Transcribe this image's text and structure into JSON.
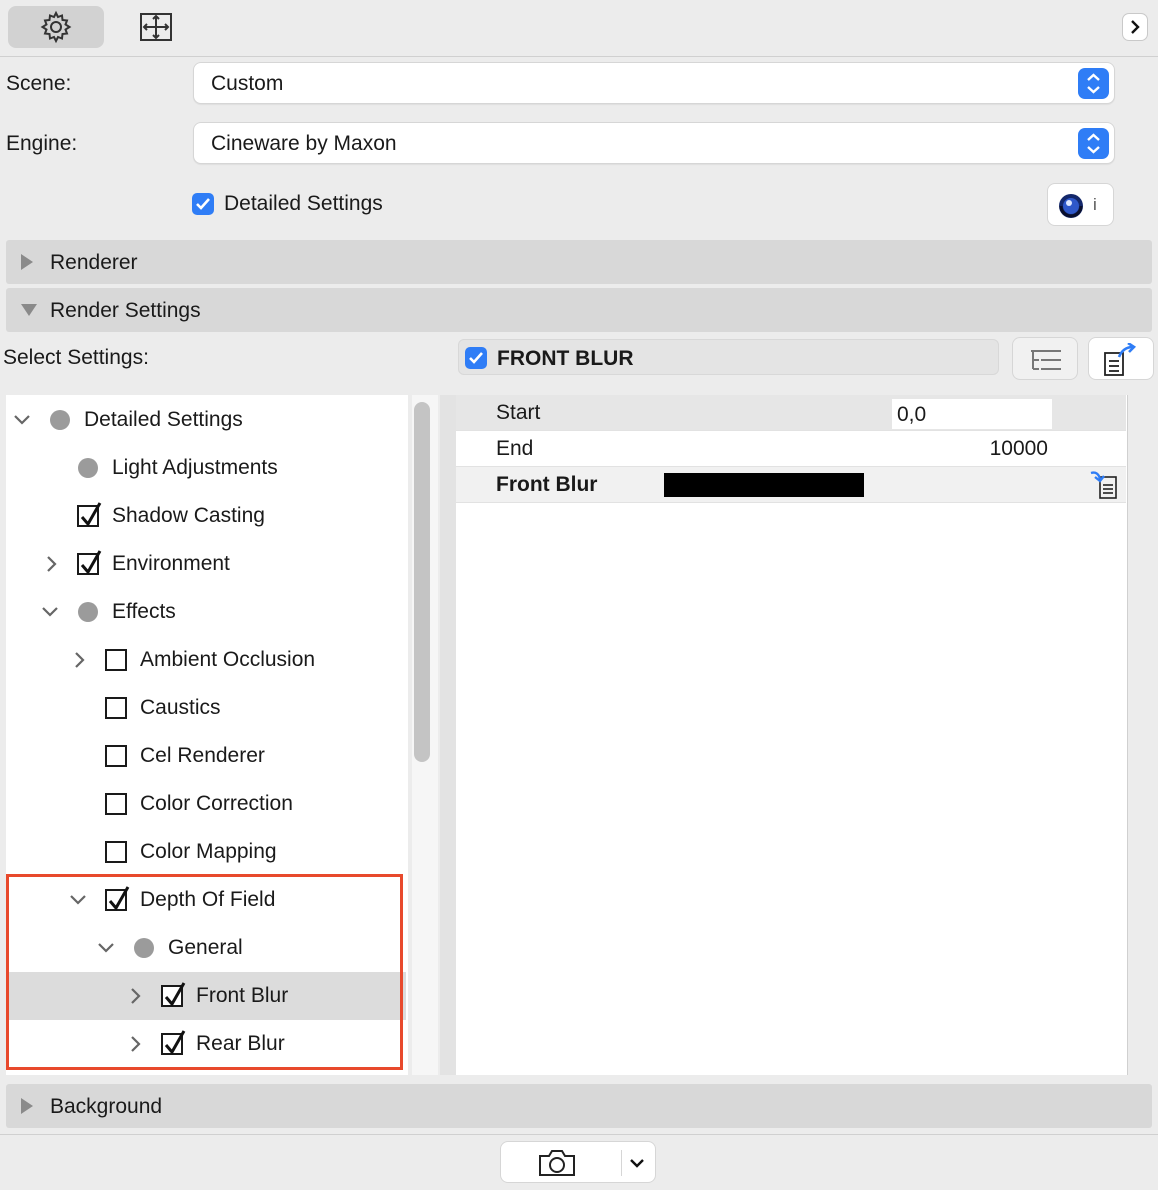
{
  "toolbar": {
    "tabs": [
      {
        "icon": "gear-icon"
      },
      {
        "icon": "size-icon"
      }
    ],
    "collapse_icon": "chevron-right-icon"
  },
  "scene": {
    "label": "Scene:",
    "value": "Custom"
  },
  "engine": {
    "label": "Engine:",
    "value": "Cineware by Maxon"
  },
  "detailed_settings": {
    "label": "Detailed Settings",
    "checked": true
  },
  "sections": {
    "renderer": "Renderer",
    "render_settings": "Render Settings",
    "background": "Background"
  },
  "select_settings": {
    "label": "Select Settings:",
    "selected_name": "FRONT BLUR",
    "checked": true
  },
  "tree": {
    "items": [
      {
        "label": "Detailed Settings"
      },
      {
        "label": "Light Adjustments"
      },
      {
        "label": "Shadow Casting"
      },
      {
        "label": "Environment"
      },
      {
        "label": "Effects"
      },
      {
        "label": "Ambient Occlusion"
      },
      {
        "label": "Caustics"
      },
      {
        "label": "Cel Renderer"
      },
      {
        "label": "Color Correction"
      },
      {
        "label": "Color Mapping"
      },
      {
        "label": "Depth Of Field"
      },
      {
        "label": "General"
      },
      {
        "label": "Front Blur"
      },
      {
        "label": "Rear Blur"
      }
    ]
  },
  "properties": {
    "rows": [
      {
        "label": "Start",
        "value": "0,0"
      },
      {
        "label": "End",
        "value": "10000"
      },
      {
        "label": "Front Blur",
        "color": "#000000"
      }
    ]
  },
  "colors": {
    "accent": "#2f7df6",
    "highlight_border": "#e8492c"
  }
}
